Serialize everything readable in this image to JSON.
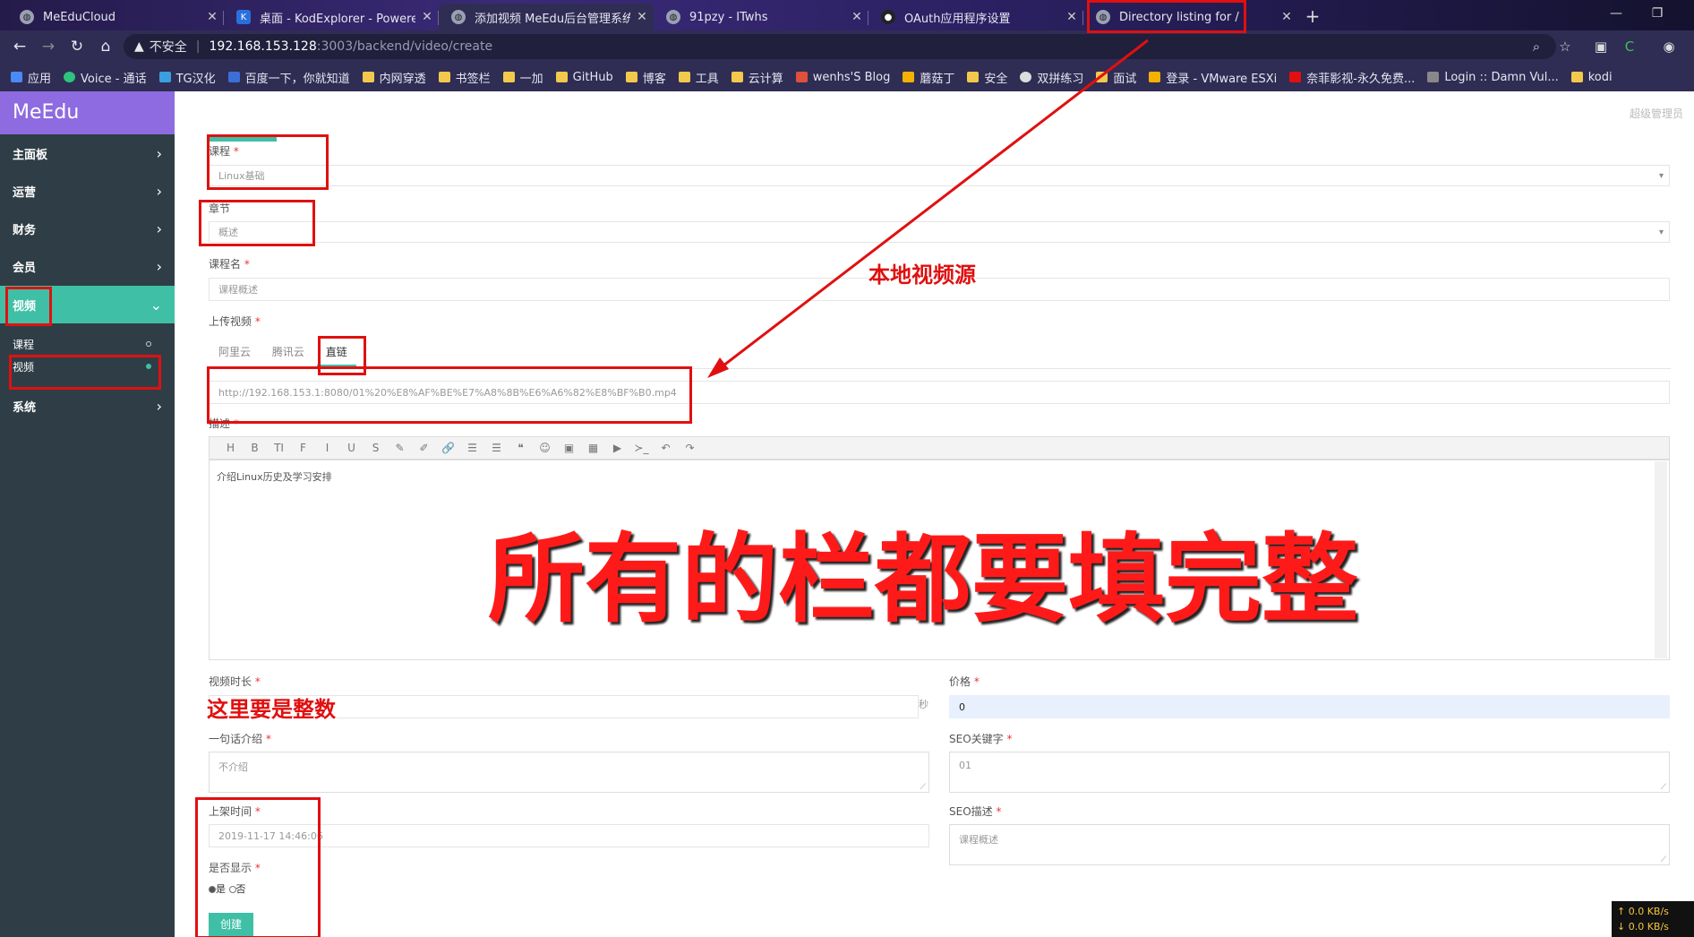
{
  "browser": {
    "tabs": [
      {
        "title": "MeEduCloud",
        "icon": "globe-icon",
        "active": false
      },
      {
        "title": "桌面 - KodExplorer - Powered",
        "icon": "kod-icon",
        "active": false
      },
      {
        "title": "添加视频 MeEdu后台管理系统",
        "icon": "globe-icon",
        "active": true
      },
      {
        "title": "91pzy - ITwhs",
        "icon": "globe-icon",
        "active": false
      },
      {
        "title": "OAuth应用程序设置",
        "icon": "github-icon",
        "active": false
      },
      {
        "title": "Directory listing for /",
        "icon": "globe-icon",
        "active": false
      }
    ],
    "address": {
      "insecure_label": "不安全",
      "host": "192.168.153.128",
      "path": ":3003/backend/video/create"
    },
    "bookmarks": [
      "应用",
      "Voice - 通话",
      "TG汉化",
      "百度一下，你就知道",
      "内网穿透",
      "书签栏",
      "一加",
      "GitHub",
      "博客",
      "工具",
      "云计算",
      "wenhs'S Blog",
      "蘑菇丁",
      "安全",
      "双拼练习",
      "面试",
      "登录 - VMware ESXi",
      "奈菲影视-永久免费...",
      "Login :: Damn Vul...",
      "kodi"
    ]
  },
  "sidebar": {
    "brand": "MeEdu",
    "items": [
      {
        "label": "主面板"
      },
      {
        "label": "运营"
      },
      {
        "label": "财务"
      },
      {
        "label": "会员"
      },
      {
        "label": "视频"
      },
      {
        "label": "系统"
      }
    ],
    "subitems": [
      {
        "label": "课程"
      },
      {
        "label": "视频"
      }
    ]
  },
  "header": {
    "user_label": "超级管理员"
  },
  "form": {
    "course_label": "课程",
    "course_value": "Linux基础",
    "chapter_label": "章节",
    "chapter_value": "概述",
    "course_name_label": "课程名",
    "course_name_placeholder": "课程概述",
    "upload_label": "上传视频",
    "upload_tabs": [
      "阿里云",
      "腾讯云",
      "直链"
    ],
    "video_url": "http://192.168.153.1:8080/01%20%E8%AF%BE%E7%A8%8B%E6%A6%82%E8%BF%B0.mp4",
    "desc_label": "描述",
    "editor_tools": [
      "H",
      "B",
      "TI",
      "F",
      "I",
      "U",
      "S",
      "✎",
      "✐",
      "🔗",
      "☰",
      "☰",
      "❝",
      "☺",
      "▣",
      "▦",
      "▶",
      "≻_",
      "↶",
      "↷"
    ],
    "editor_content": "介绍Linux历史及学习安排",
    "duration_label": "视频时长",
    "duration_unit": "秒",
    "price_label": "价格",
    "price_value": "0",
    "oneliner_label": "一句话介绍",
    "oneliner_placeholder": "不介绍",
    "seo_keywords_label": "SEO关键字",
    "seo_keywords_value": "01",
    "publish_time_label": "上架时间",
    "publish_time_value": "2019-11-17 14:46:06",
    "seo_desc_label": "SEO描述",
    "seo_desc_placeholder": "课程概述",
    "show_label": "是否显示",
    "show_yes": "是",
    "show_no": "否",
    "create_button": "创建",
    "required_mark": "*"
  },
  "annotations": {
    "local_source": "本地视频源",
    "fill_all": "所有的栏都要填完整",
    "integer_note": "这里要是整数"
  },
  "netmon": {
    "up": "↑ 0.0 KB/s",
    "down": "↓ 0.0 KB/s"
  }
}
